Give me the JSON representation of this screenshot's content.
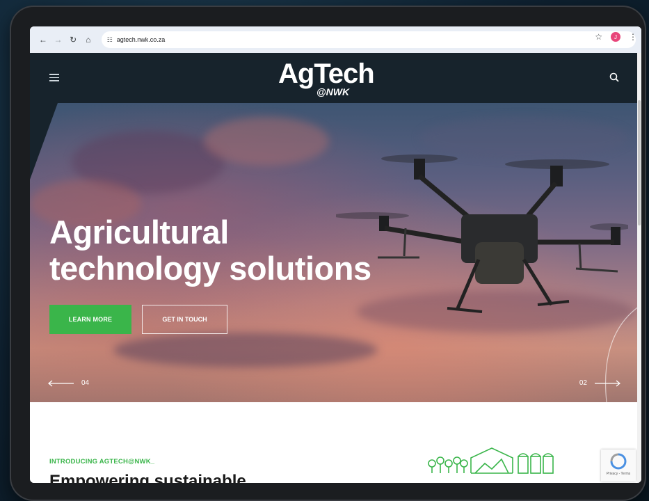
{
  "browser": {
    "url": "agtech.nwk.co.za",
    "profile_initial": "J"
  },
  "header": {
    "logo_main": "AgTech",
    "logo_sub": "@NWK"
  },
  "hero": {
    "title_line1": "Agricultural",
    "title_line2": "technology solutions",
    "learn_more": "LEARN MORE",
    "get_in_touch": "GET IN TOUCH",
    "prev_number": "04",
    "next_number": "02"
  },
  "intro": {
    "label": "INTRODUCING AGTECH@NWK_",
    "heading": "Empowering sustainable"
  },
  "recaptcha": {
    "text": "Privacy - Terms"
  },
  "colors": {
    "accent_green": "#3ab54a",
    "header_bg": "#17232c"
  }
}
